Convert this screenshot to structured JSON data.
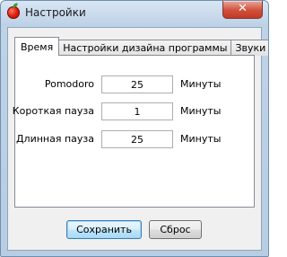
{
  "window": {
    "title": "Настройки",
    "close_glyph": "✕"
  },
  "tabs": [
    {
      "label": "Время",
      "active": true
    },
    {
      "label": "Настройки дизайна программы",
      "active": false
    },
    {
      "label": "Звуки",
      "active": false
    }
  ],
  "fields": [
    {
      "label": "Pomodoro",
      "value": "25",
      "unit": "Минуты"
    },
    {
      "label": "Короткая пауза",
      "value": "1",
      "unit": "Минуты"
    },
    {
      "label": "Длинная пауза",
      "value": "25",
      "unit": "Минуты"
    }
  ],
  "buttons": {
    "save": "Сохранить",
    "reset": "Сброс"
  },
  "colors": {
    "close_button": "#c9412d",
    "default_button_border": "#3c7fb1"
  }
}
